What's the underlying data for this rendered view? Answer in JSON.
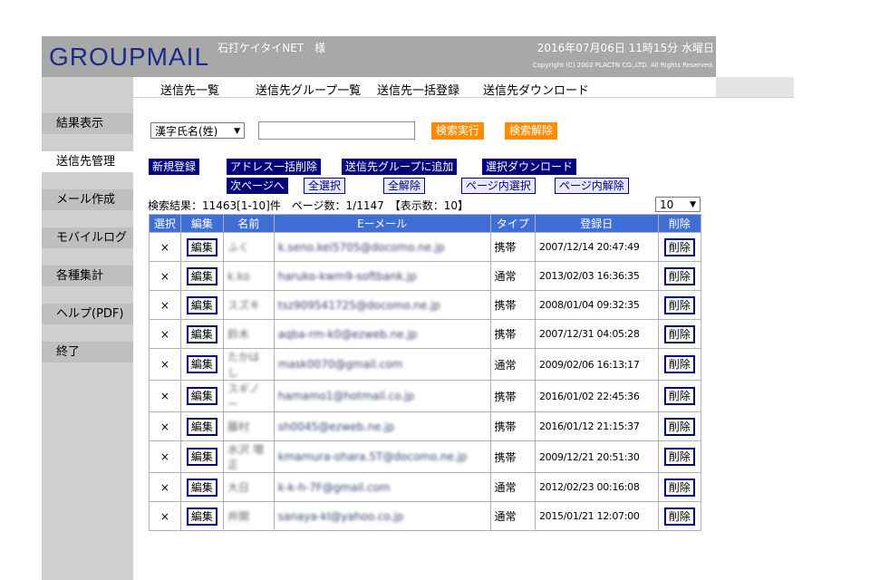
{
  "header": {
    "logo": "GROUPMAIL",
    "user": "石打ケイタイNET　様",
    "datetime": "2016年07月06日  11時15分 水曜日",
    "copyright": "Copyright (C) 2002 PLACTN CO.,LTD. All Rights Reserved."
  },
  "sidebar": {
    "items": [
      {
        "label": "結果表示"
      },
      {
        "label": "送信先管理"
      },
      {
        "label": "メール作成"
      },
      {
        "label": "モバイルログ"
      },
      {
        "label": "各種集計"
      },
      {
        "label": "ヘルプ(PDF)"
      },
      {
        "label": "終了"
      }
    ]
  },
  "topnav": {
    "items": [
      {
        "label": "送信先一覧"
      },
      {
        "label": "送信先グループ一覧"
      },
      {
        "label": "送信先一括登録"
      },
      {
        "label": "送信先ダウンロード"
      }
    ]
  },
  "search": {
    "field_selected": "漢字氏名(姓)",
    "query": "",
    "execute_label": "検索実行",
    "clear_label": "検索解除"
  },
  "actions": {
    "new_register": "新規登録",
    "bulk_delete": "アドレス一括削除",
    "add_to_group": "送信先グループに追加",
    "selected_download": "選択ダウンロード",
    "next_page": "次ページへ",
    "select_all": "全選択",
    "deselect_all": "全解除",
    "select_in_page": "ページ内選択",
    "deselect_in_page": "ページ内解除"
  },
  "results": {
    "info": "検索結果：11463[1-10]件　ページ数：1/1147　【表示数：10】",
    "per_page": "10"
  },
  "table": {
    "headers": [
      "選択",
      "編集",
      "名前",
      "Eーメール",
      "タイプ",
      "登録日",
      "削除"
    ],
    "edit_label": "編集",
    "delete_label": "削除",
    "rows": [
      {
        "mark": "×",
        "name": "ふく",
        "email": "k.seno.kei5705@docomo.ne.jp",
        "type": "携帯",
        "date": "2007/12/14 20:47:49"
      },
      {
        "mark": "×",
        "name": "k.ko",
        "email": "haruko-kwm9-softbank.jp",
        "type": "通常",
        "date": "2013/02/03 16:36:35"
      },
      {
        "mark": "×",
        "name": "スズキ",
        "email": "tsz909541725@docomo.ne.jp",
        "type": "携帯",
        "date": "2008/01/04 09:32:35"
      },
      {
        "mark": "×",
        "name": "鈴木",
        "email": "aqba-rm-k0@ezweb.ne.jp",
        "type": "携帯",
        "date": "2007/12/31 04:05:28"
      },
      {
        "mark": "×",
        "name": "たかはし",
        "email": "mask0070@gmail.com",
        "type": "通常",
        "date": "2009/02/06 16:13:17"
      },
      {
        "mark": "×",
        "name": "スギノー",
        "email": "hamamo1@hotmail.co.jp",
        "type": "携帯",
        "date": "2016/01/02 22:45:36"
      },
      {
        "mark": "×",
        "name": "藤村",
        "email": "sh0045@ezweb.ne.jp",
        "type": "携帯",
        "date": "2016/01/12 21:15:37"
      },
      {
        "mark": "×",
        "name": "水沢 増正",
        "email": "kmamura-ohara.5T@docomo.ne.jp",
        "type": "携帯",
        "date": "2009/12/21 20:51:30"
      },
      {
        "mark": "×",
        "name": "大日",
        "email": "k-k-h-7F@gmail.com",
        "type": "通常",
        "date": "2012/02/23 00:16:08"
      },
      {
        "mark": "×",
        "name": "井関",
        "email": "sanaya-kl@yahoo.co.jp",
        "type": "通常",
        "date": "2015/01/21 12:07:00"
      }
    ]
  }
}
